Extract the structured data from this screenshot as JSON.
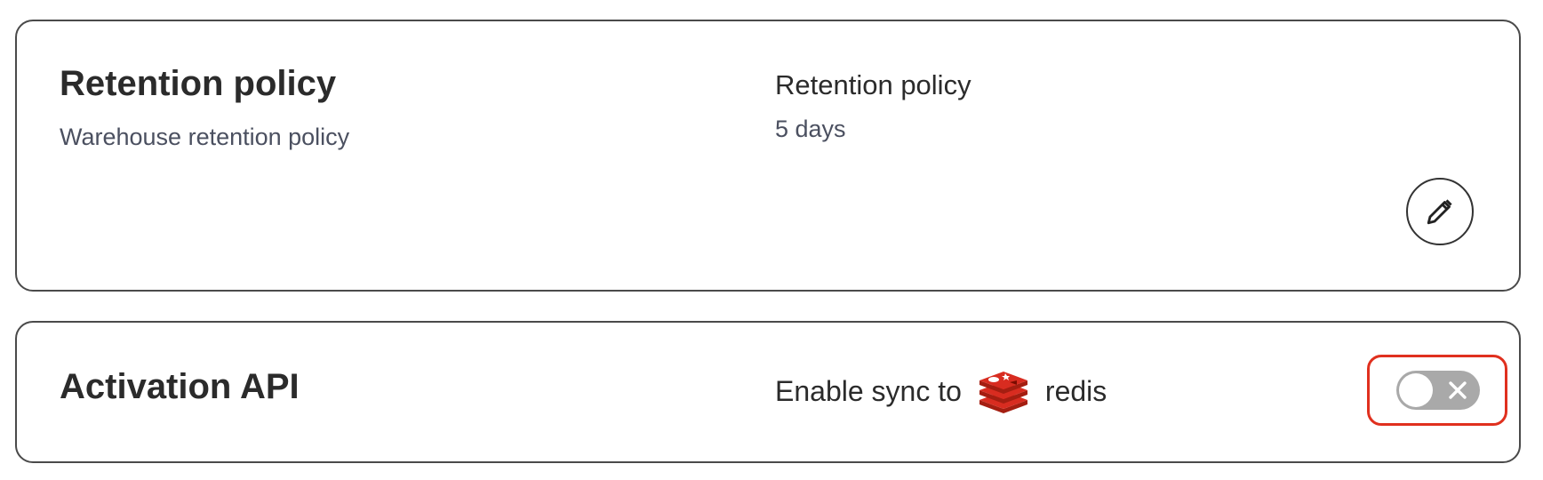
{
  "retention_card": {
    "title": "Retention policy",
    "subtitle": "Warehouse retention policy",
    "field_label": "Retention policy",
    "field_value": "5 days",
    "edit_icon": "pencil-icon"
  },
  "activation_card": {
    "title": "Activation API",
    "sync_label": "Enable sync to",
    "destination_name": "redis",
    "destination_icon": "redis-logo-icon",
    "toggle_state": "off",
    "toggle_icon": "close-icon",
    "highlight_color": "#e0301e"
  }
}
